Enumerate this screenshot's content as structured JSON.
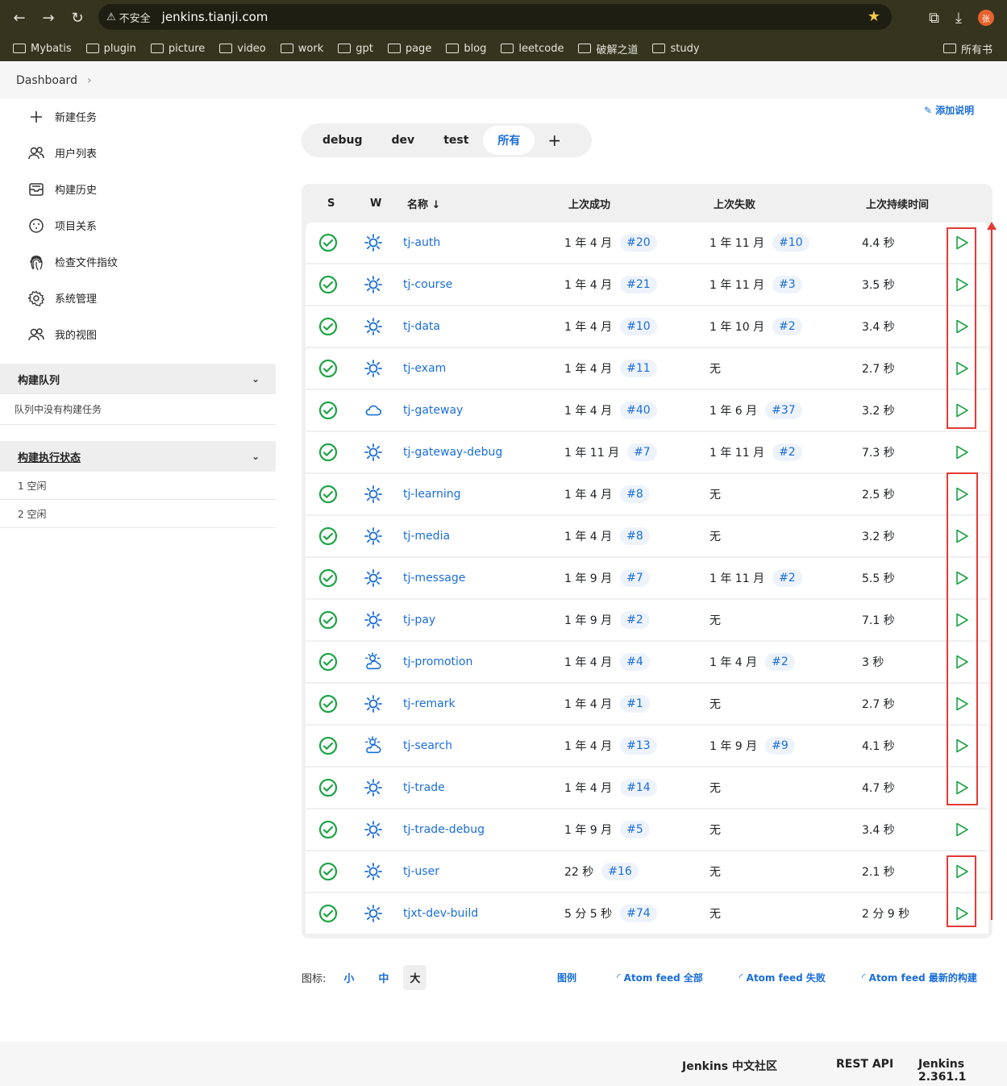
{
  "browser": {
    "insecure_label": "不安全",
    "url": "jenkins.tianji.com",
    "profile_initial": "张",
    "bookmarks": [
      "Mybatis",
      "plugin",
      "picture",
      "video",
      "work",
      "gpt",
      "page",
      "blog",
      "leetcode",
      "破解之道",
      "study"
    ],
    "bookmarks_right": "所有书"
  },
  "breadcrumb": {
    "root": "Dashboard"
  },
  "sidebar": {
    "items": [
      {
        "label": "新建任务",
        "icon": "plus-icon"
      },
      {
        "label": "用户列表",
        "icon": "users-icon"
      },
      {
        "label": "构建历史",
        "icon": "history-icon"
      },
      {
        "label": "项目关系",
        "icon": "relation-icon"
      },
      {
        "label": "检查文件指纹",
        "icon": "fingerprint-icon"
      },
      {
        "label": "系统管理",
        "icon": "gear-icon"
      },
      {
        "label": "我的视图",
        "icon": "users-icon"
      }
    ],
    "queue": {
      "title": "构建队列",
      "empty_text": "队列中没有构建任务"
    },
    "executors": {
      "title": "构建执行状态",
      "items": [
        "1  空闲",
        "2  空闲"
      ]
    }
  },
  "main": {
    "add_description": "添加说明",
    "tabs": [
      "debug",
      "dev",
      "test",
      "所有"
    ],
    "active_tab": "所有",
    "columns": {
      "s": "S",
      "w": "W",
      "name": "名称 ↓",
      "last_success": "上次成功",
      "last_failure": "上次失败",
      "last_duration": "上次持续时间"
    },
    "jobs": [
      {
        "name": "tj-auth",
        "weather": "sunny",
        "ok": "1 年 4 月",
        "ok_build": "#20",
        "fail": "1 年 11 月",
        "fail_build": "#10",
        "dur": "4.4 秒"
      },
      {
        "name": "tj-course",
        "weather": "sunny",
        "ok": "1 年 4 月",
        "ok_build": "#21",
        "fail": "1 年 11 月",
        "fail_build": "#3",
        "dur": "3.5 秒"
      },
      {
        "name": "tj-data",
        "weather": "sunny",
        "ok": "1 年 4 月",
        "ok_build": "#10",
        "fail": "1 年 10 月",
        "fail_build": "#2",
        "dur": "3.4 秒"
      },
      {
        "name": "tj-exam",
        "weather": "sunny",
        "ok": "1 年 4 月",
        "ok_build": "#11",
        "fail": "无",
        "fail_build": "",
        "dur": "2.7 秒"
      },
      {
        "name": "tj-gateway",
        "weather": "cloudy",
        "ok": "1 年 4 月",
        "ok_build": "#40",
        "fail": "1 年 6 月",
        "fail_build": "#37",
        "dur": "3.2 秒"
      },
      {
        "name": "tj-gateway-debug",
        "weather": "sunny",
        "ok": "1 年 11 月",
        "ok_build": "#7",
        "fail": "1 年 11 月",
        "fail_build": "#2",
        "dur": "7.3 秒"
      },
      {
        "name": "tj-learning",
        "weather": "sunny",
        "ok": "1 年 4 月",
        "ok_build": "#8",
        "fail": "无",
        "fail_build": "",
        "dur": "2.5 秒"
      },
      {
        "name": "tj-media",
        "weather": "sunny",
        "ok": "1 年 4 月",
        "ok_build": "#8",
        "fail": "无",
        "fail_build": "",
        "dur": "3.2 秒"
      },
      {
        "name": "tj-message",
        "weather": "sunny",
        "ok": "1 年 9 月",
        "ok_build": "#7",
        "fail": "1 年 11 月",
        "fail_build": "#2",
        "dur": "5.5 秒"
      },
      {
        "name": "tj-pay",
        "weather": "sunny",
        "ok": "1 年 9 月",
        "ok_build": "#2",
        "fail": "无",
        "fail_build": "",
        "dur": "7.1 秒"
      },
      {
        "name": "tj-promotion",
        "weather": "partly-cloudy",
        "ok": "1 年 4 月",
        "ok_build": "#4",
        "fail": "1 年 4 月",
        "fail_build": "#2",
        "dur": "3 秒"
      },
      {
        "name": "tj-remark",
        "weather": "sunny",
        "ok": "1 年 4 月",
        "ok_build": "#1",
        "fail": "无",
        "fail_build": "",
        "dur": "2.7 秒"
      },
      {
        "name": "tj-search",
        "weather": "partly-cloudy",
        "ok": "1 年 4 月",
        "ok_build": "#13",
        "fail": "1 年 9 月",
        "fail_build": "#9",
        "dur": "4.1 秒"
      },
      {
        "name": "tj-trade",
        "weather": "sunny",
        "ok": "1 年 4 月",
        "ok_build": "#14",
        "fail": "无",
        "fail_build": "",
        "dur": "4.7 秒"
      },
      {
        "name": "tj-trade-debug",
        "weather": "sunny",
        "ok": "1 年 9 月",
        "ok_build": "#5",
        "fail": "无",
        "fail_build": "",
        "dur": "3.4 秒"
      },
      {
        "name": "tj-user",
        "weather": "sunny",
        "ok": "22 秒",
        "ok_build": "#16",
        "fail": "无",
        "fail_build": "",
        "dur": "2.1 秒"
      },
      {
        "name": "tjxt-dev-build",
        "weather": "sunny",
        "ok": "5 分 5 秒",
        "ok_build": "#74",
        "fail": "无",
        "fail_build": "",
        "dur": "2 分 9 秒"
      }
    ]
  },
  "legend": {
    "icon_label": "图标:",
    "sizes": [
      "小",
      "中",
      "大"
    ],
    "active_size": "大",
    "legend_link": "图例",
    "feed_all": "Atom feed 全部",
    "feed_fail": "Atom feed 失败",
    "feed_latest": "Atom feed 最新的构建"
  },
  "footer": {
    "community": "Jenkins 中文社区",
    "rest_api": "REST API",
    "version": "Jenkins 2.361.1"
  },
  "colors": {
    "accent": "#1a6ed8",
    "success": "#1ea446",
    "annotation": "#e53935"
  }
}
